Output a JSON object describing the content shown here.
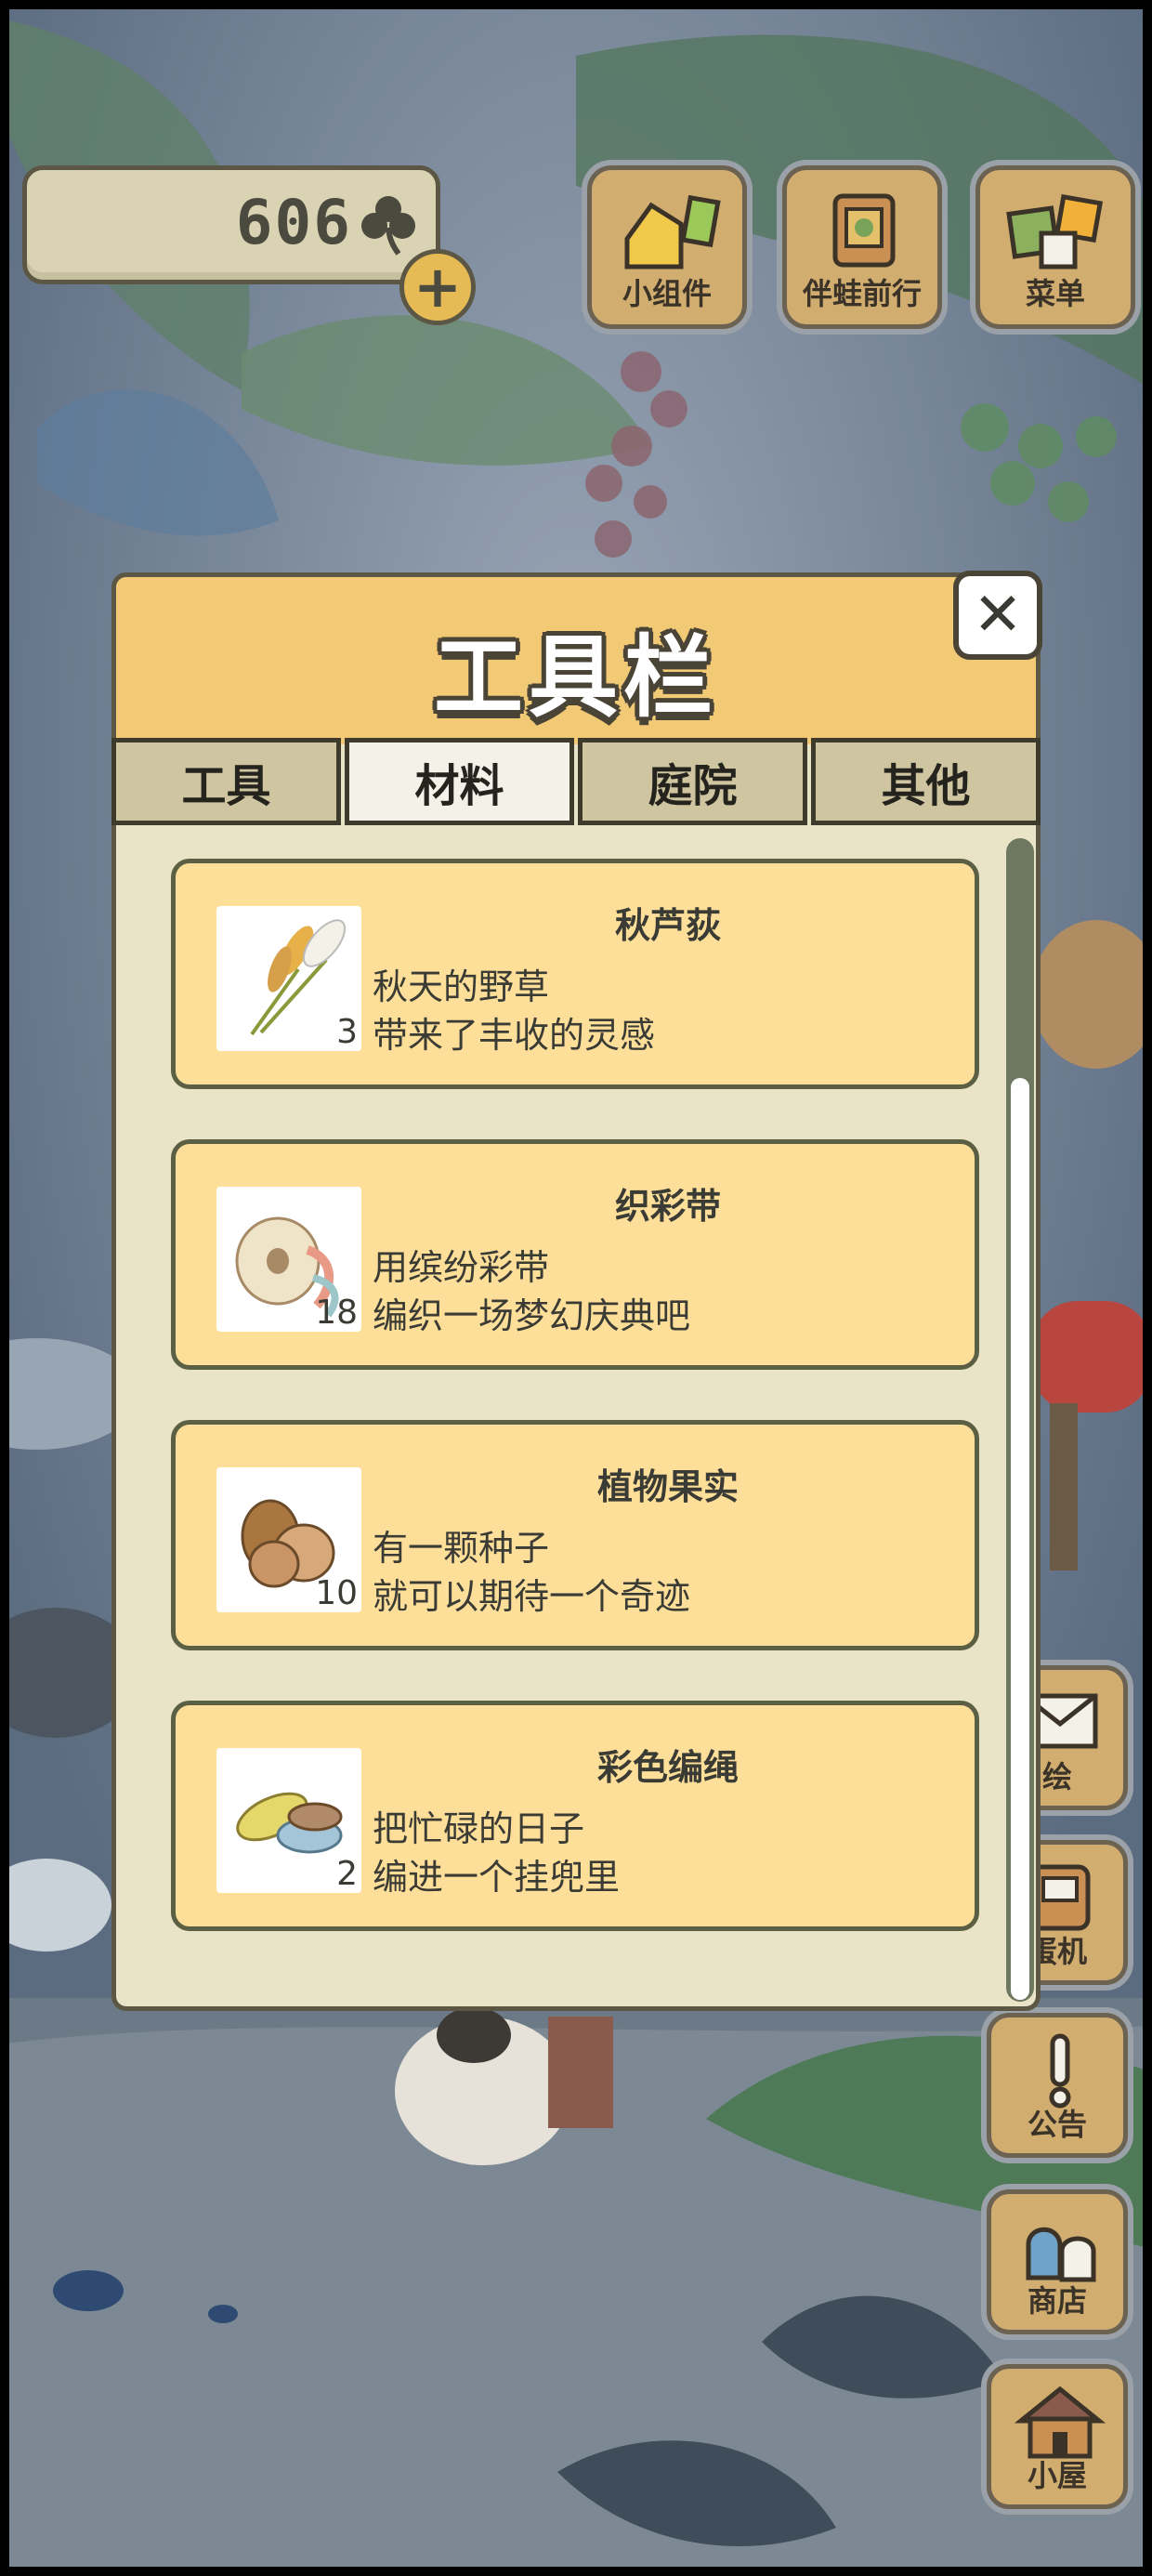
{
  "hud": {
    "clover_count": "606",
    "plus_label": "+"
  },
  "top_buttons": [
    {
      "label": "小组件",
      "icon": "widget-icon"
    },
    {
      "label": "伴蛙前行",
      "icon": "journey-icon"
    },
    {
      "label": "菜单",
      "icon": "menu-icon"
    }
  ],
  "side_buttons": [
    {
      "label": "绘",
      "icon": "letter-icon"
    },
    {
      "label": "蛋机",
      "icon": "gacha-icon"
    },
    {
      "label": "公告",
      "icon": "notice-icon"
    },
    {
      "label": "商店",
      "icon": "shop-icon"
    },
    {
      "label": "小屋",
      "icon": "house-icon"
    }
  ],
  "modal": {
    "title": "工具栏",
    "close_label": "✕",
    "tabs": [
      {
        "label": "工具",
        "active": false
      },
      {
        "label": "材料",
        "active": true
      },
      {
        "label": "庭院",
        "active": false
      },
      {
        "label": "其他",
        "active": false
      }
    ],
    "items": [
      {
        "name": "秋芦荻",
        "desc_line1": "秋天的野草",
        "desc_line2": "带来了丰收的灵感",
        "qty": "3",
        "icon": "reed-icon"
      },
      {
        "name": "织彩带",
        "desc_line1": "用缤纷彩带",
        "desc_line2": "编织一场梦幻庆典吧",
        "qty": "18",
        "icon": "ribbon-icon"
      },
      {
        "name": "植物果实",
        "desc_line1": "有一颗种子",
        "desc_line2": "就可以期待一个奇迹",
        "qty": "10",
        "icon": "nuts-icon"
      },
      {
        "name": "彩色编绳",
        "desc_line1": "把忙碌的日子",
        "desc_line2": "编进一个挂兜里",
        "qty": "2",
        "icon": "rope-icon"
      }
    ]
  },
  "colors": {
    "modal_header": "#f2c975",
    "card_bg": "#fddf99",
    "button_wood": "#d1ad6f"
  }
}
